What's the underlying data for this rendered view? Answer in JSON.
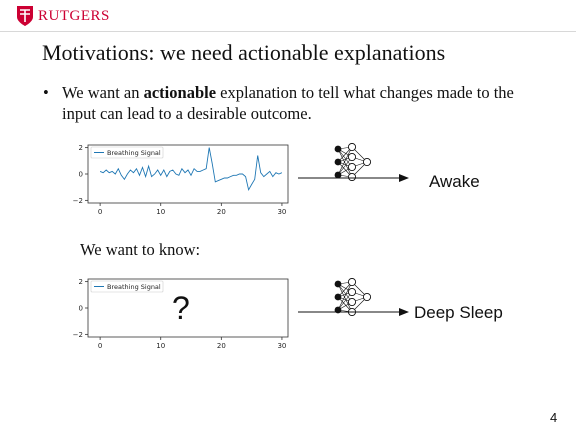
{
  "header": {
    "logo_text": "RUTGERS",
    "logo_color": "#cc0033"
  },
  "slide": {
    "title": "Motivations: we need actionable explanations",
    "bullet": {
      "marker": "•",
      "prefix": "We want an ",
      "bold": "actionable",
      "suffix": " explanation to tell what changes made to the input can lead to a desirable outcome."
    },
    "subheading": "We want to know:",
    "page_number": "4"
  },
  "example1": {
    "output_label": "Awake",
    "model_icon": "neural-network-icon"
  },
  "example2": {
    "output_label": "Deep Sleep",
    "unknown_mark": "?",
    "model_icon": "neural-network-icon"
  },
  "chart_data": [
    {
      "type": "line",
      "series": [
        {
          "name": "Breathing Signal",
          "color": "#1f77b4",
          "x": [
            0,
            0.5,
            1,
            1.5,
            2,
            2.5,
            3,
            3.5,
            4,
            4.5,
            5,
            5.5,
            6,
            6.5,
            7,
            7.5,
            8,
            8.5,
            9,
            9.5,
            10,
            10.5,
            11,
            11.5,
            12,
            12.5,
            13,
            13.5,
            14,
            14.5,
            15,
            15.5,
            16,
            16.5,
            17,
            17.5,
            18,
            18.5,
            19,
            19.5,
            20,
            20.5,
            21,
            21.5,
            22,
            22.5,
            23,
            23.5,
            24,
            24.5,
            25,
            25.5,
            26,
            26.5,
            27,
            27.5,
            28,
            28.5,
            29,
            29.5,
            30
          ],
          "values": [
            0.2,
            0.1,
            0.3,
            0.1,
            0.2,
            0.0,
            0.4,
            -0.1,
            -0.4,
            0.0,
            0.3,
            0.1,
            0.4,
            -0.1,
            0.5,
            -0.2,
            0.6,
            -0.2,
            0.0,
            0.3,
            -0.1,
            0.3,
            -0.2,
            0.2,
            0.3,
            0.0,
            -0.1,
            0.4,
            0.1,
            0.3,
            -0.1,
            0.4,
            0.2,
            0.2,
            0.3,
            0.4,
            2.0,
            0.8,
            -0.6,
            -0.5,
            -0.4,
            -0.3,
            -0.3,
            -0.2,
            -0.1,
            -0.1,
            0.0,
            0.0,
            -0.2,
            -1.2,
            -0.8,
            -0.4,
            1.4,
            0.1,
            -0.2,
            0.0,
            0.2,
            -0.2,
            0.1,
            0.0,
            0.1
          ]
        }
      ],
      "xticks": [
        "0",
        "10",
        "20",
        "30"
      ],
      "yticks": [
        "2",
        "0",
        "−2"
      ],
      "xlim": [
        -2,
        31
      ],
      "ylim": [
        -2.2,
        2.2
      ]
    },
    {
      "type": "line",
      "series": [
        {
          "name": "Breathing Signal",
          "color": "#1f77b4",
          "x": [],
          "values": []
        }
      ],
      "xticks": [
        "0",
        "10",
        "20",
        "30"
      ],
      "yticks": [
        "2",
        "0",
        "−2"
      ],
      "xlim": [
        -2,
        31
      ],
      "ylim": [
        -2.2,
        2.2
      ]
    }
  ]
}
